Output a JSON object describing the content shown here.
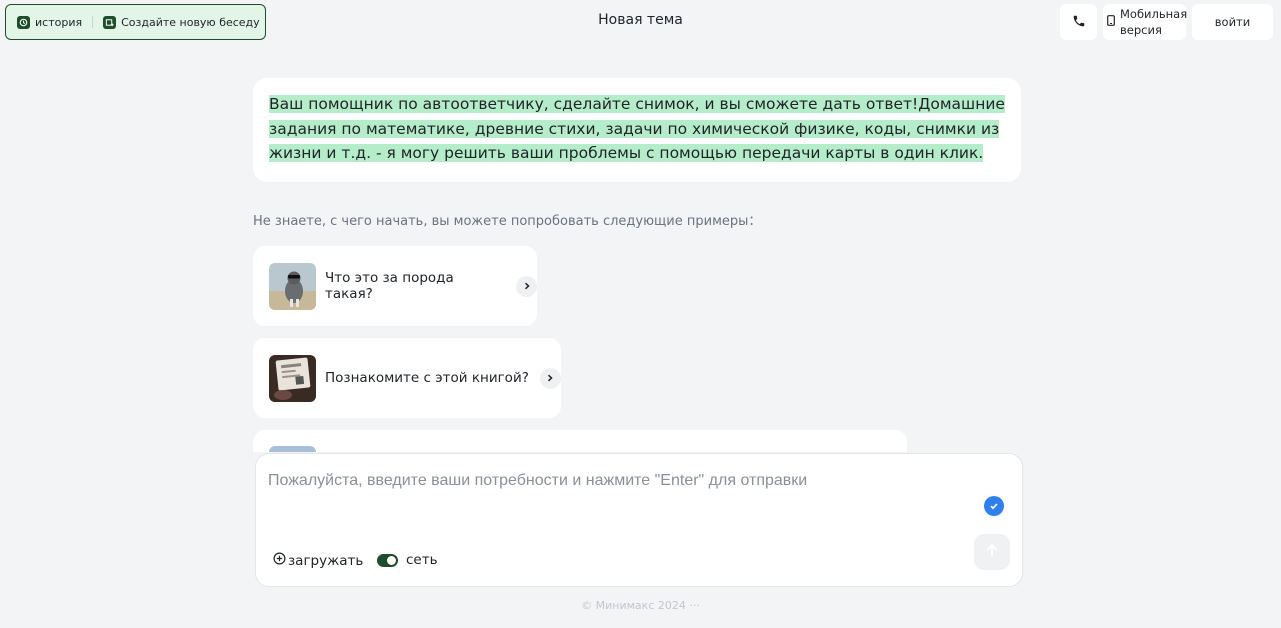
{
  "header": {
    "history_label": "история",
    "new_chat_label": "Создайте новую беседу",
    "title": "Новая тема",
    "mobile_label_line1": "Мобильная",
    "mobile_label_line2": "версия",
    "login_label": "войти",
    "accent_color": "#1e4d2b"
  },
  "intro": {
    "text": "Ваш помощник по автоответчику, сделайте снимок, и вы сможете дать ответ!Домашние задания по математике, древние стихи, задачи по химической физике, коды, снимки из жизни и т.д. - я могу решить ваши проблемы с помощью передачи карты в один клик.",
    "highlight_color": "#b5ecc9"
  },
  "examples": {
    "hint": "Не знаете, с чего начать, вы можете попробовать следующие примеры：",
    "items": [
      {
        "label": "Что это за порода такая?",
        "icon": "cat-photo"
      },
      {
        "label": "Познакомите с этой книгой?",
        "icon": "book-photo"
      },
      {
        "label": "",
        "icon": "photo"
      }
    ]
  },
  "composer": {
    "placeholder": "Пожалуйста, введите ваши потребности и нажмите \"Enter\" для отправки",
    "upload_label": "загружать",
    "network_label": "сеть",
    "network_enabled": true
  },
  "footer": {
    "text": "© Минимакс 2024 ···"
  }
}
